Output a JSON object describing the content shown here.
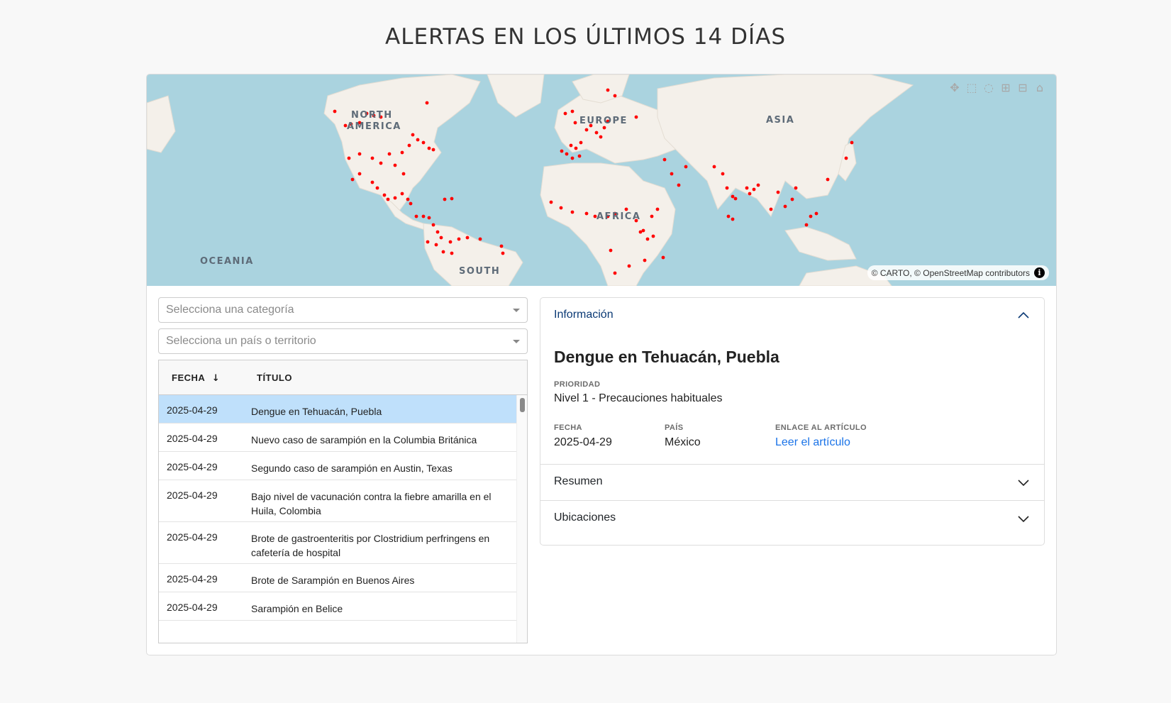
{
  "page_title": "ALERTAS EN LOS ÚLTIMOS 14 DÍAS",
  "map": {
    "labels": {
      "north_america_1": "NORTH",
      "north_america_2": "AMERICA",
      "europe": "EUROPE",
      "asia": "ASIA",
      "africa": "AFRICA",
      "oceania": "OCEANIA",
      "south": "SOUTH"
    },
    "attribution": {
      "carto": "© CARTO, © ",
      "osm": "OpenStreetMap",
      "contributors": "contributors",
      "info": "i"
    },
    "modebar": [
      "pan-icon",
      "box-select-icon",
      "lasso-select-icon",
      "zoom-in-icon",
      "zoom-out-icon",
      "home-icon"
    ],
    "marker_color": "#ff0000"
  },
  "filters": {
    "category_placeholder": "Selecciona una categoría",
    "country_placeholder": "Selecciona un país o territorio"
  },
  "table": {
    "headers": {
      "date": "FECHA",
      "title": "TÍTULO",
      "sort": "↓"
    },
    "rows": [
      {
        "date": "2025-04-29",
        "title": "Dengue en Tehuacán, Puebla"
      },
      {
        "date": "2025-04-29",
        "title": "Nuevo caso de sarampión en la Columbia Británica"
      },
      {
        "date": "2025-04-29",
        "title": "Segundo caso de sarampión en Austin, Texas"
      },
      {
        "date": "2025-04-29",
        "title": "Bajo nivel de vacunación contra la fiebre amarilla en el Huila, Colombia"
      },
      {
        "date": "2025-04-29",
        "title": "Brote de gastroenteritis por Clostridium perfringens en cafetería de hospital"
      },
      {
        "date": "2025-04-29",
        "title": "Brote de Sarampión en Buenos Aires"
      },
      {
        "date": "2025-04-29",
        "title": "Sarampión en Belice"
      }
    ]
  },
  "accordion": {
    "info_label": "Información",
    "summary_label": "Resumen",
    "locations_label": "Ubicaciones",
    "detail": {
      "title": "Dengue en Tehuacán, Puebla",
      "priority_label": "PRIORIDAD",
      "priority_value": "Nivel 1 - Precauciones habituales",
      "date_label": "FECHA",
      "date_value": "2025-04-29",
      "country_label": "PAÍS",
      "country_value": "México",
      "link_label": "ENLACE AL ARTÍCULO",
      "link_text": "Leer el artículo"
    }
  }
}
